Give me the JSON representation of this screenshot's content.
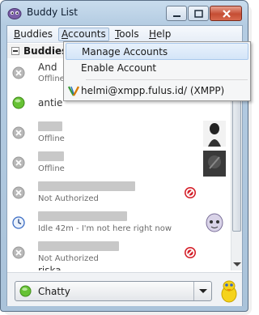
{
  "window": {
    "title": "Buddy List"
  },
  "menubar": [
    {
      "label": "Buddies",
      "u": "B",
      "rest": "uddies"
    },
    {
      "label": "Accounts",
      "u": "A",
      "rest": "ccounts"
    },
    {
      "label": "Tools",
      "u": "T",
      "rest": "ools"
    },
    {
      "label": "Help",
      "u": "H",
      "rest": "elp"
    }
  ],
  "accounts_menu": {
    "items": [
      {
        "label": "Manage Accounts"
      },
      {
        "label": "Enable Account"
      },
      {
        "label": "helmi@xmpp.fulus.id/ (XMPP)"
      }
    ]
  },
  "group": {
    "label": "Buddies"
  },
  "buddies": [
    {
      "name": "And",
      "status": "Offline",
      "state": "offline"
    },
    {
      "name": "antie",
      "status": "",
      "state": "available"
    },
    {
      "name": "",
      "status": "Offline",
      "state": "offline"
    },
    {
      "name": "",
      "status": "Offline",
      "state": "offline"
    },
    {
      "name": "",
      "status": "Not Authorized",
      "state": "offline"
    },
    {
      "name": "",
      "status": "Idle 42m - I'm not here right now",
      "state": "idle"
    },
    {
      "name": "",
      "status": "Not Authorized",
      "state": "offline"
    },
    {
      "name": "riska",
      "status": "",
      "state": "offline"
    }
  ],
  "status_selector": {
    "value": "Chatty"
  },
  "colors": {
    "available": "#5cb82a",
    "offline": "#a9a9a9",
    "blocked": "#d4202a",
    "idle": "#3a6cc4"
  }
}
